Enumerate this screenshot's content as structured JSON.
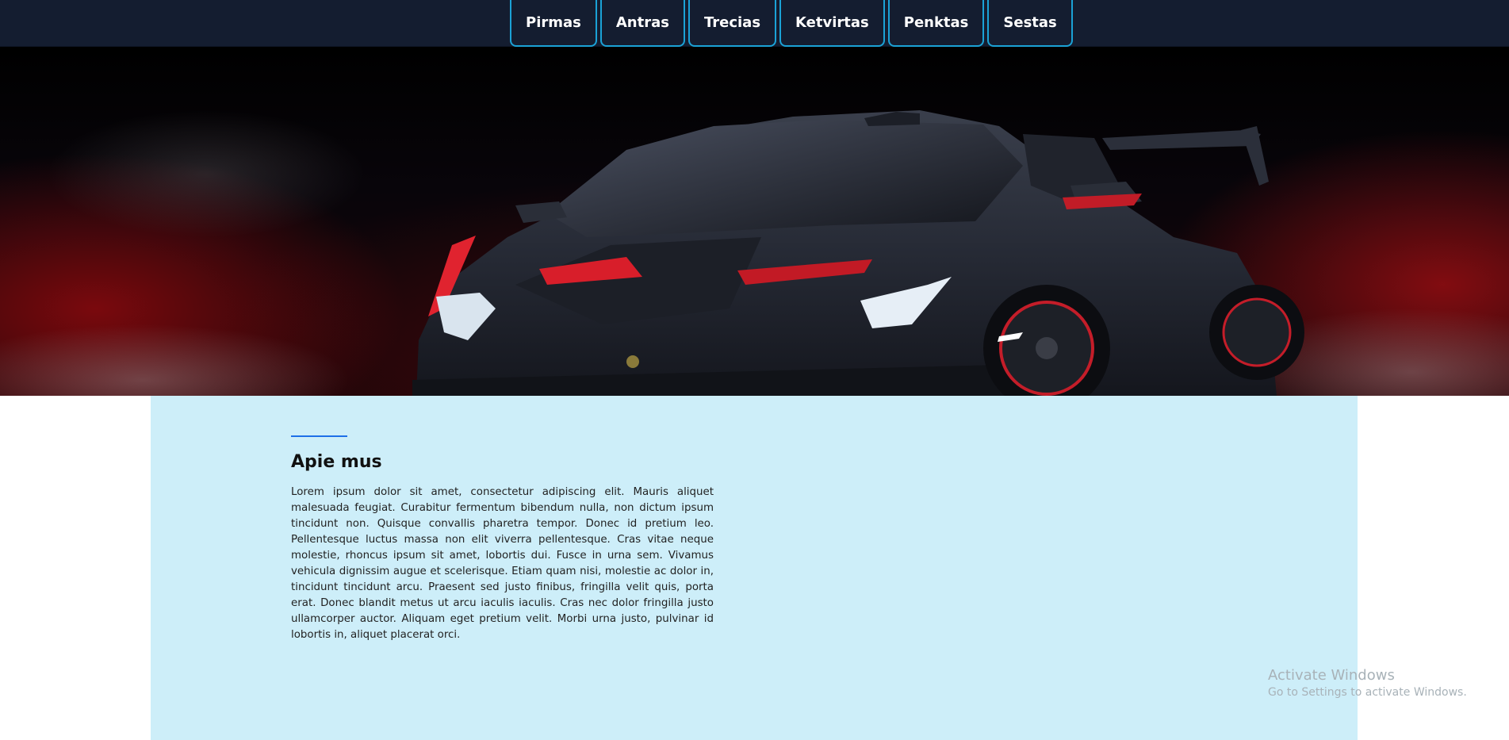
{
  "nav": {
    "items": [
      {
        "label": "Pirmas"
      },
      {
        "label": "Antras"
      },
      {
        "label": "Trecias"
      },
      {
        "label": "Ketvirtas"
      },
      {
        "label": "Penktas"
      },
      {
        "label": "Sestas"
      }
    ]
  },
  "hero": {
    "image": "sports-car-hero-image"
  },
  "about": {
    "title": "Apie mus",
    "text": "Lorem ipsum dolor sit amet, consectetur adipiscing elit. Mauris aliquet malesuada feugiat. Curabitur fermentum bibendum nulla, non dictum ipsum tincidunt non. Quisque convallis pharetra tempor. Donec id pretium leo. Pellentesque luctus massa non elit viverra pellentesque. Cras vitae neque molestie, rhoncus ipsum sit amet, lobortis dui. Fusce in urna sem. Vivamus vehicula dignissim augue et scelerisque. Etiam quam nisi, molestie ac dolor in, tincidunt tincidunt arcu. Praesent sed justo finibus, fringilla velit quis, porta erat. Donec blandit metus ut arcu iaculis iaculis. Cras nec dolor fringilla justo ullamcorper auctor. Aliquam eget pretium velit. Morbi urna justo, pulvinar id lobortis in, aliquet placerat orci."
  },
  "watermark": {
    "title": "Activate Windows",
    "subtitle": "Go to Settings to activate Windows."
  },
  "colors": {
    "topbar": "#141d30",
    "nav_border": "#1ba2d6",
    "content_bg": "#cdeef9",
    "accent": "#1e6fe8"
  }
}
